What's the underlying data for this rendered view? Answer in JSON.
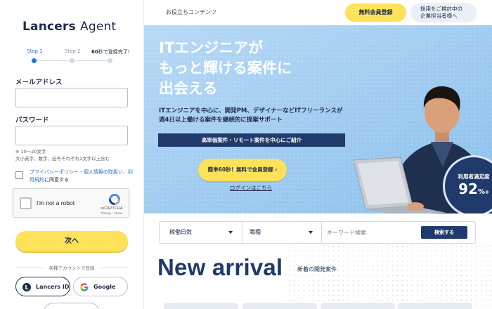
{
  "sidebar": {
    "logo": "Lancers Agent",
    "steps": {
      "step1": "Step 1",
      "step2": "Step 2",
      "step3_bold": "60",
      "step3_rest": "秒で登録完了!"
    },
    "email_label": "メールアドレス",
    "email_value": "",
    "password_label": "パスワード",
    "password_value": "",
    "password_hint_line1": "※ 10〜20文字",
    "password_hint_line2": "大小英字、数字、記号それぞれ1文字以上含む",
    "consent_link": "プライバシーポリシー・個人情報の取扱い、利用規約",
    "consent_text": "に同意する",
    "recaptcha_label": "I'm not a robot",
    "recaptcha_brand": "reCAPTCHA",
    "recaptcha_sub": "Privacy - Terms",
    "next_button": "次へ",
    "social_divider": "各種アカウントで登録",
    "lancers_id_button": "Lancers ID",
    "google_button": "Google"
  },
  "header": {
    "useful_content": "お役立ちコンテンツ",
    "register_button": "無料会員登録",
    "corporate_button": "採用をご検討中の\n企業担当者様へ"
  },
  "hero": {
    "title": "ITエンジニアが\nもっと輝ける案件に\n出会える",
    "subtitle": "ITエンジニアを中心に、開発PM、デザイナーなどITフリーランスが\n週4日以上働ける案件を継続的に提案サポート",
    "band": "高単価案件・リモート案件を中心にご紹介",
    "cta_button": "簡単60秒！無料で会員登録  ›",
    "login_link": "ログインはこちら",
    "badge_label": "利用者満足度",
    "badge_value": "92",
    "badge_unit": "%",
    "badge_note": "※"
  },
  "search": {
    "operating_days": "稼働日数",
    "job_type": "職種",
    "keyword_placeholder": "キーワード検索",
    "search_button": "検索する"
  },
  "arrival": {
    "title": "New arrival",
    "subtitle": "新着の開発案件"
  },
  "colors": {
    "navy": "#1f3a6b",
    "yellow": "#fde25a",
    "hero_blue": "#a9cff1",
    "link_blue": "#2a6fd6"
  }
}
